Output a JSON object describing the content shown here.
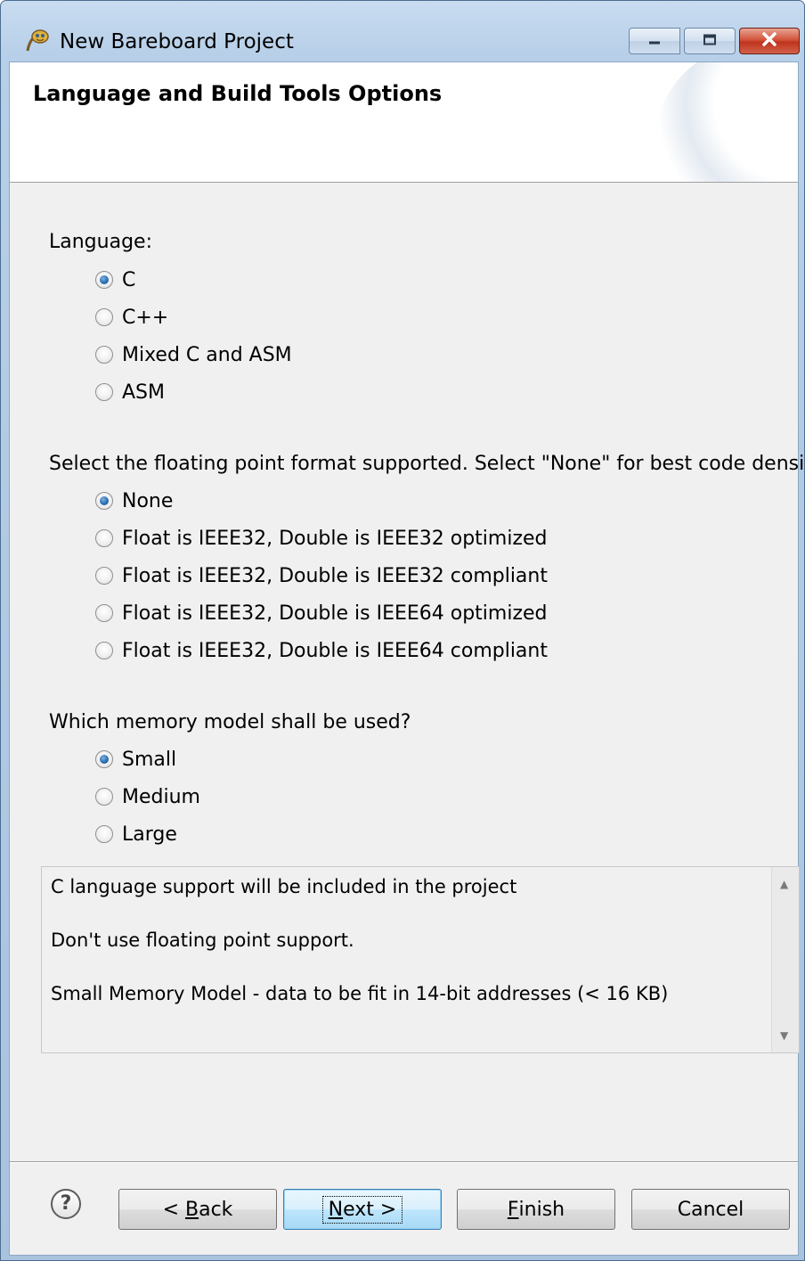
{
  "window": {
    "title": "New Bareboard Project",
    "controls": {
      "minimize": "minimize",
      "maximize": "maximize",
      "close": "close"
    }
  },
  "header": {
    "title": "Language and Build Tools Options"
  },
  "sections": [
    {
      "label": "Language:",
      "options": [
        {
          "label": "C",
          "selected": true
        },
        {
          "label": "C++",
          "selected": false
        },
        {
          "label": "Mixed C and ASM",
          "selected": false
        },
        {
          "label": "ASM",
          "selected": false
        }
      ]
    },
    {
      "label": "Select the floating point format supported. Select \"None\" for best code density.",
      "options": [
        {
          "label": "None",
          "selected": true
        },
        {
          "label": "Float is IEEE32, Double is IEEE32 optimized",
          "selected": false
        },
        {
          "label": "Float is IEEE32, Double is IEEE32 compliant",
          "selected": false
        },
        {
          "label": "Float is IEEE32, Double is IEEE64 optimized",
          "selected": false
        },
        {
          "label": "Float is IEEE32, Double is IEEE64 compliant",
          "selected": false
        }
      ]
    },
    {
      "label": "Which memory model shall be used?",
      "options": [
        {
          "label": "Small",
          "selected": true
        },
        {
          "label": "Medium",
          "selected": false
        },
        {
          "label": "Large",
          "selected": false
        }
      ]
    }
  ],
  "description": {
    "lines": [
      "C language support will be included in the project",
      "Don't use floating point support.",
      "Small Memory Model - data to be fit in 14-bit addresses (< 16 KB)"
    ]
  },
  "footer": {
    "help": "?",
    "back": {
      "prefix": "< ",
      "mnemonic": "B",
      "rest": "ack"
    },
    "next": {
      "prefix": "",
      "mnemonic": "N",
      "rest": "ext >"
    },
    "finish": {
      "prefix": "",
      "mnemonic": "F",
      "rest": "inish"
    },
    "cancel": "Cancel"
  },
  "colors": {
    "accent": "#3c7fb1",
    "radio_selected": "#2a6fb3",
    "title_bar": "#b7cfe8",
    "close_button": "#c0341e"
  }
}
